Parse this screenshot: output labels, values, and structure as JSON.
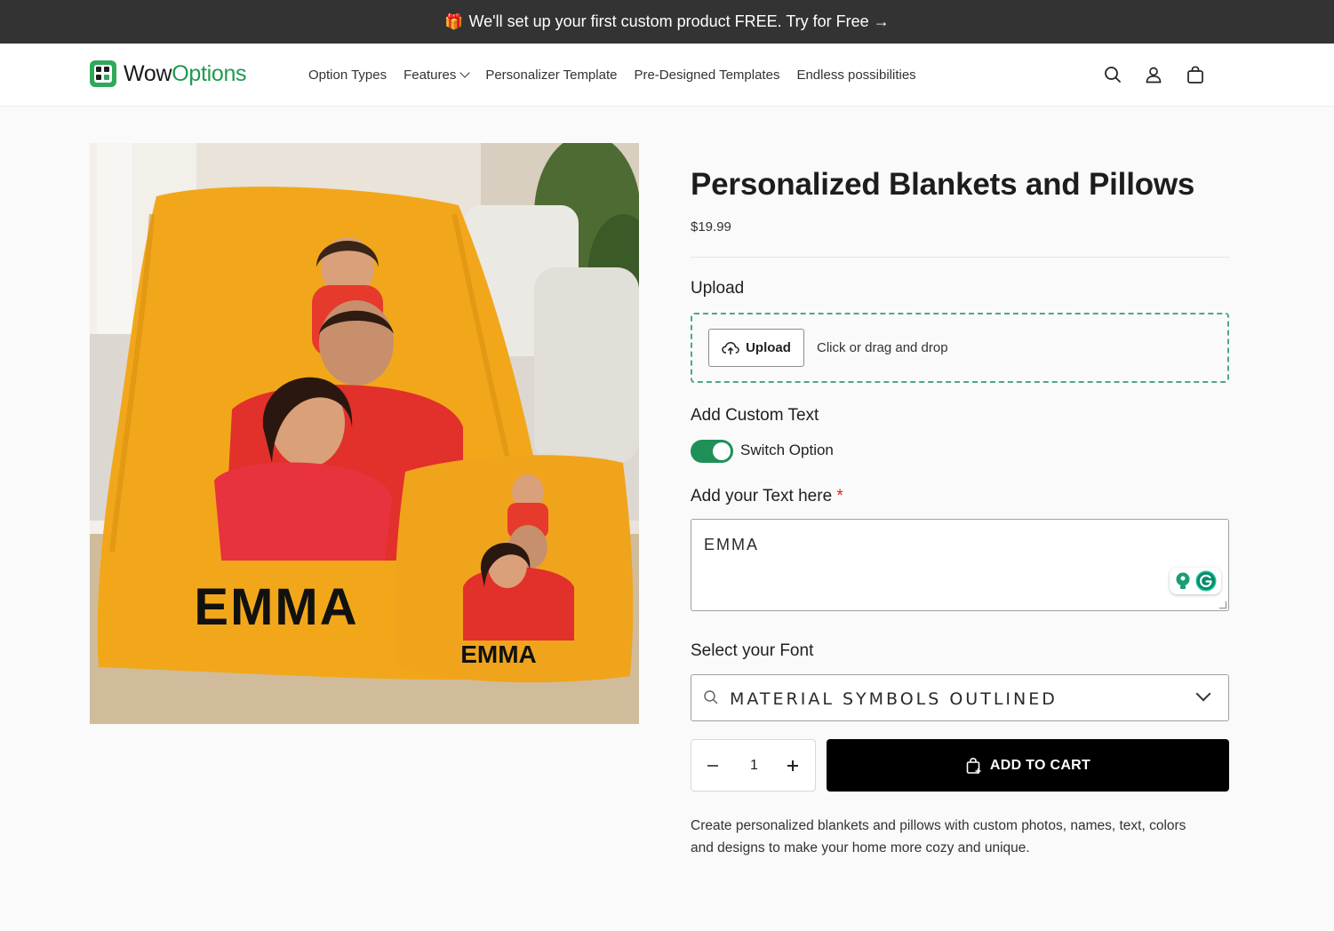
{
  "announcement": {
    "gift_icon": "🎁",
    "text": "We'll set up your first custom product FREE. Try for Free →"
  },
  "header": {
    "logo": {
      "prefix": "Wow",
      "accent": "Options",
      "accent_color": "#1f9a4e"
    },
    "nav": [
      {
        "label": "Option Types"
      },
      {
        "label": "Features"
      },
      {
        "label": "Personalizer Template"
      },
      {
        "label": "Pre-Designed Templates"
      },
      {
        "label": "Endless possibilities"
      }
    ],
    "icons": [
      "search-icon",
      "account-icon",
      "cart-icon"
    ]
  },
  "product": {
    "image_text": {
      "blanket": "EMMA",
      "pillow": "EMMA"
    },
    "title": "Personalized Blankets and Pillows",
    "price": "$19.99",
    "upload": {
      "label": "Upload",
      "button": "Upload",
      "hint": "Click or drag and drop"
    },
    "custom_text": {
      "label": "Add Custom Text",
      "switch_label": "Switch Option",
      "switch_on": true
    },
    "text_input": {
      "label": "Add your Text here",
      "required_mark": "*",
      "value": "EMMA"
    },
    "font": {
      "label": "Select your Font",
      "value": "MATERIAL SYMBOLS OUTLINED"
    },
    "quantity": {
      "minus": "−",
      "value": "1",
      "plus": "+"
    },
    "add_to_cart": "ADD TO CART",
    "description": "Create personalized blankets and pillows with custom photos, names, text, colors and designs to make your home more cozy and unique."
  },
  "colors": {
    "announcement_bg": "#333333",
    "brand_green": "#1f9a4e",
    "switch_on": "#1f9058",
    "cta_bg": "#000000",
    "blanket_yellow": "#f2a71b"
  }
}
